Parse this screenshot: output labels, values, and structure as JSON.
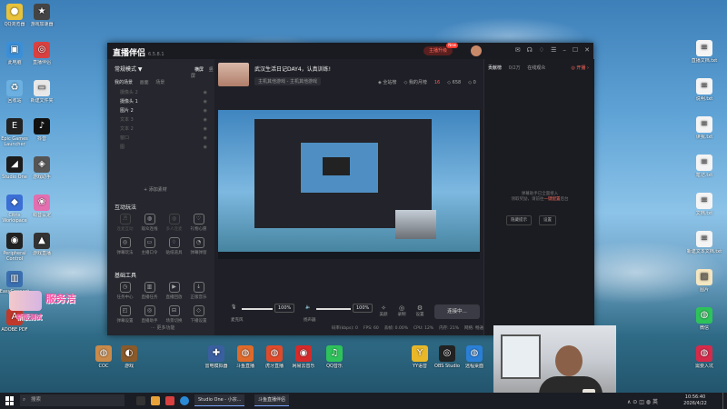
{
  "desktop": {
    "left_icons": [
      {
        "label": "QQ浏览器",
        "glyph": "●",
        "color": "#e8c23a"
      },
      {
        "label": "此电脑",
        "glyph": "▣",
        "color": "#3a8fd8"
      },
      {
        "label": "回收站",
        "glyph": "♻",
        "color": "#6bb0e0"
      },
      {
        "label": "Epic Games Launcher",
        "glyph": "E",
        "color": "#222"
      },
      {
        "label": "Studio One",
        "glyph": "◢",
        "color": "#1c1c1c"
      },
      {
        "label": "Citrix Workspace",
        "glyph": "◆",
        "color": "#3b6fd6"
      },
      {
        "label": "Peripheral Control",
        "glyph": "◉",
        "color": "#222"
      },
      {
        "label": "EasyConnect",
        "glyph": "▥",
        "color": "#3a6fb0"
      },
      {
        "label": "ADOBE PDF",
        "glyph": "A",
        "color": "#c0392b"
      }
    ],
    "col2_icons": [
      {
        "label": "游戏加速器",
        "glyph": "★",
        "color": "#444"
      },
      {
        "label": "直播伴侣",
        "glyph": "◎",
        "color": "#d94040"
      },
      {
        "label": "新建文件夹",
        "glyph": "▭",
        "color": "#e8e8e8"
      },
      {
        "label": "抖音",
        "glyph": "♪",
        "color": "#111"
      },
      {
        "label": "游戏助手",
        "glyph": "◈",
        "color": "#555"
      },
      {
        "label": "萌音设定",
        "glyph": "❀",
        "color": "#e36fb0"
      },
      {
        "label": "游戏直播",
        "glyph": "▲",
        "color": "#333"
      }
    ],
    "bottom_icons": [
      {
        "label": "COC",
        "glyph": "◍",
        "color": "#c98a4a"
      },
      {
        "label": "游戏",
        "glyph": "◐",
        "color": "#8a5a2a"
      },
      {
        "label": "雷电模拟器",
        "glyph": "✚",
        "color": "#3a5fa0"
      },
      {
        "label": "斗鱼直播",
        "glyph": "◍",
        "color": "#e06a2a"
      },
      {
        "label": "虎牙直播",
        "glyph": "◍",
        "color": "#e04a2a"
      },
      {
        "label": "网易云音乐",
        "glyph": "◉",
        "color": "#d62a2a"
      },
      {
        "label": "QQ音乐",
        "glyph": "♫",
        "color": "#2ec25a"
      },
      {
        "label": "YY语音",
        "glyph": "Y",
        "color": "#e8b82a"
      },
      {
        "label": "OBS Studio",
        "glyph": "◎",
        "color": "#222"
      },
      {
        "label": "远程桌面",
        "glyph": "◍",
        "color": "#2a7fd6"
      }
    ],
    "right_icons": [
      {
        "label": "直播文档.txt",
        "glyph": "≡",
        "color": "#f4f4f4"
      },
      {
        "label": "说明.txt",
        "glyph": "≡",
        "color": "#f4f4f4"
      },
      {
        "label": "读我.txt",
        "glyph": "≡",
        "color": "#f4f4f4"
      },
      {
        "label": "笔记.txt",
        "glyph": "≡",
        "color": "#f4f4f4"
      },
      {
        "label": "文档.txt",
        "glyph": "≡",
        "color": "#f4f4f4"
      },
      {
        "label": "新建文本文档.txt",
        "glyph": "≡",
        "color": "#f4f4f4"
      },
      {
        "label": "图片",
        "glyph": "▨",
        "color": "#f4e6c0"
      },
      {
        "label": "微信",
        "glyph": "◍",
        "color": "#2ec25a"
      },
      {
        "label": "需要入坑",
        "glyph": "◍",
        "color": "#d62a4a"
      }
    ],
    "promo": {
      "big": "服务洁",
      "small": "新版测试"
    }
  },
  "window": {
    "brand": "直播伴侣",
    "version": "6.5.8.1",
    "upgrade_label": "主播升级",
    "upgrade_badge": "New",
    "titlebar_icons": [
      "message-icon",
      "headset-icon",
      "skin-icon",
      "menu-icon",
      "minimize-icon",
      "maximize-icon",
      "close-icon"
    ]
  },
  "left_panel": {
    "mode": "常规模式 ▼",
    "mode_tabs": [
      "横屏",
      "竖屏"
    ],
    "subtabs": [
      "我的场景",
      "画面",
      "场景"
    ],
    "scenes": [
      {
        "name": "摄像头 2",
        "on": false
      },
      {
        "name": "摄像头 1",
        "on": true
      },
      {
        "name": "图片 2",
        "on": true
      },
      {
        "name": "文本 3",
        "on": false
      },
      {
        "name": "文本 2",
        "on": false
      },
      {
        "name": "窗口",
        "on": false
      },
      {
        "name": "图",
        "on": false
      }
    ],
    "add_material": "+ 添加素材",
    "interaction_title": "互动玩法",
    "interaction_items": [
      {
        "label": "连麦互动",
        "glyph": "♬",
        "dim": true
      },
      {
        "label": "观众连线",
        "glyph": "◍",
        "dim": false
      },
      {
        "label": "多人连麦",
        "glyph": "◍",
        "dim": true
      },
      {
        "label": "礼物心愿",
        "glyph": "♡",
        "dim": false
      },
      {
        "label": "弹幕玩法",
        "glyph": "◎",
        "dim": false
      },
      {
        "label": "主播口令",
        "glyph": "▭",
        "dim": false
      },
      {
        "label": "贴纸道具",
        "glyph": "♢",
        "dim": false
      },
      {
        "label": "弹幕弹窗",
        "glyph": "◔",
        "dim": false
      }
    ],
    "tools_title": "基础工具",
    "tools_items": [
      {
        "label": "任务中心",
        "glyph": "◷",
        "dim": false
      },
      {
        "label": "直播任务",
        "glyph": "▥",
        "dim": false
      },
      {
        "label": "直播回放",
        "glyph": "▶",
        "dim": false
      },
      {
        "label": "正版音乐",
        "glyph": "↓",
        "dim": false
      },
      {
        "label": "弹幕设置",
        "glyph": "◰",
        "dim": false
      },
      {
        "label": "直播助手",
        "glyph": "◎",
        "dim": false
      },
      {
        "label": "场景切换",
        "glyph": "⊟",
        "dim": false
      },
      {
        "label": "下播设置",
        "glyph": "◇",
        "dim": false
      }
    ],
    "more_label": "··· 更多功能"
  },
  "center": {
    "title": "武汉生活日记DAY4，认真训练!",
    "category": "主机其他游戏 - 主机其他游戏",
    "meta": [
      {
        "label": "◈ 全站榜",
        "red": false
      },
      {
        "label": "◇ 我的月榜",
        "red": false
      },
      {
        "label": "16",
        "red": true
      },
      {
        "label": "◇ 658",
        "red": false
      },
      {
        "label": "◇ 0",
        "red": false
      }
    ],
    "mic_label": "麦克风",
    "mic_pct": "100%",
    "mic_level": 1.0,
    "speaker_label": "扬声器",
    "speaker_pct": "100%",
    "speaker_level": 1.0,
    "right_buttons": [
      {
        "label": "美颜",
        "glyph": "✧"
      },
      {
        "label": "录制",
        "glyph": "◎"
      },
      {
        "label": "设置",
        "glyph": "⚙"
      }
    ],
    "connect_label": "连接中...",
    "stats": [
      "码率(kbps): 0",
      "FPS: 60",
      "丢帧: 0.00%",
      "CPU: 12%",
      "内存: 21%",
      "网络: 畅通"
    ]
  },
  "right_panel": {
    "tabs": [
      "贡献榜",
      "在线观众"
    ],
    "count": "0/2万",
    "open_btn": "◎ 开播 ›",
    "msg_line1": "弹幕助手已全面接入",
    "msg_line2": "领取奖励，请前往",
    "msg_link": "一键配置",
    "msg_line3": "后台",
    "btn_hide": "隐藏提示",
    "btn_settings": "设置"
  },
  "taskbar": {
    "search_placeholder": "搜索",
    "apps": [
      {
        "label": "Studio One - 小宗..."
      },
      {
        "label": "斗鱼直播伴侣"
      }
    ],
    "tray": "∧  ⊙  ◫  ◍  英",
    "time": "10:56:40",
    "date": "2026/4/22"
  }
}
